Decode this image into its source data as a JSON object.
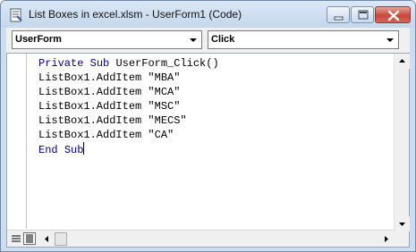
{
  "window": {
    "title": "List Boxes in excel.xlsm - UserForm1 (Code)",
    "icon": "vba-code-window-icon",
    "buttons": [
      "minimize",
      "maximize",
      "close"
    ]
  },
  "object_combo": {
    "value": "UserForm"
  },
  "procedure_combo": {
    "value": "Click"
  },
  "code": {
    "line1_kw1": "Private",
    "line1_kw2": "Sub",
    "line1_rest": "UserForm_Click()",
    "line2": "ListBox1.AddItem \"MBA\"",
    "line3": "ListBox1.AddItem \"MCA\"",
    "line4": "ListBox1.AddItem \"MSC\"",
    "line5": "ListBox1.AddItem \"MECS\"",
    "line6": "ListBox1.AddItem \"CA\"",
    "line7_kw1": "End",
    "line7_kw2": "Sub"
  },
  "colors": {
    "keyword": "#00008b",
    "text": "#000000",
    "window_frame": "#cddcee",
    "close_button": "#c7473a"
  }
}
